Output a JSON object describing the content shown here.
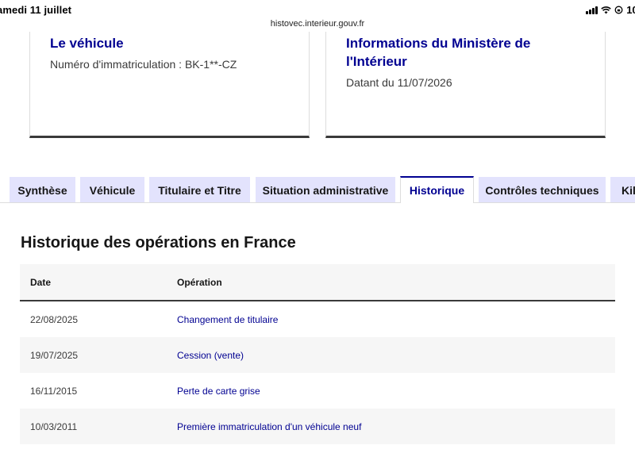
{
  "status_bar": {
    "time_date": "amedi 11 juillet",
    "battery": "10("
  },
  "browser": {
    "url": "histovec.interieur.gouv.fr"
  },
  "cards": [
    {
      "title": "Le véhicule",
      "description": "Numéro d'immatriculation : BK-1**-CZ"
    },
    {
      "title": "Informations du Ministère de l'Intérieur",
      "description": "Datant du 11/07/2026"
    }
  ],
  "tabs": [
    {
      "label": "Synthèse",
      "active": false
    },
    {
      "label": "Véhicule",
      "active": false
    },
    {
      "label": "Titulaire et Titre",
      "active": false
    },
    {
      "label": "Situation administrative",
      "active": false
    },
    {
      "label": "Historique",
      "active": true
    },
    {
      "label": "Contrôles techniques",
      "active": false
    },
    {
      "label": "Kil",
      "active": false
    }
  ],
  "history": {
    "title": "Historique des opérations en France",
    "columns": {
      "date": "Date",
      "operation": "Opération"
    },
    "rows": [
      {
        "date": "22/08/2025",
        "operation": "Changement de titulaire"
      },
      {
        "date": "19/07/2025",
        "operation": "Cession (vente)"
      },
      {
        "date": "16/11/2015",
        "operation": "Perte de carte grise"
      },
      {
        "date": "10/03/2011",
        "operation": "Première immatriculation d'un véhicule neuf"
      }
    ]
  },
  "colors": {
    "accent": "#000091",
    "tab_inactive": "#e3e3fd",
    "row_alt": "#f6f6f6"
  }
}
